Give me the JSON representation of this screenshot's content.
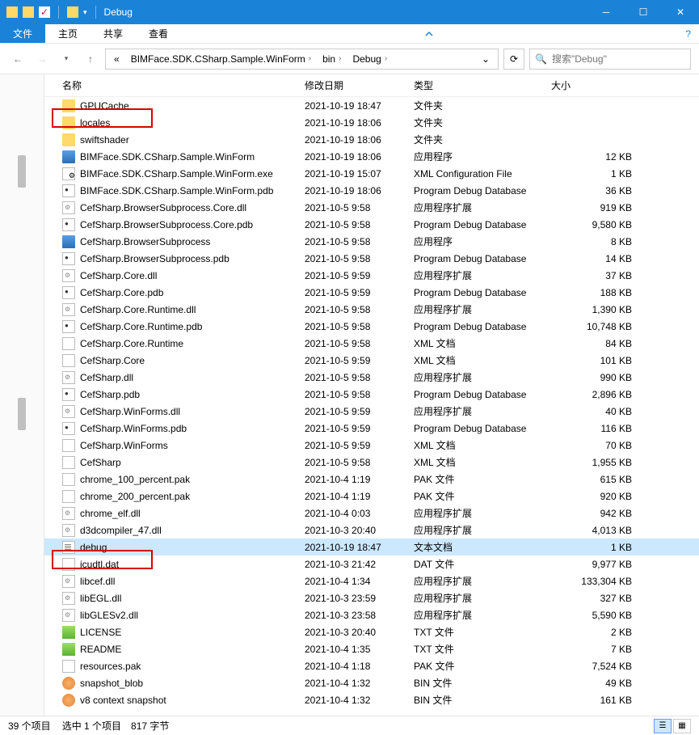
{
  "title": "Debug",
  "ribbon": {
    "file": "文件",
    "home": "主页",
    "share": "共享",
    "view": "查看"
  },
  "breadcrumb": {
    "part1": "BIMFace.SDK.CSharp.Sample.WinForm",
    "part2": "bin",
    "part3": "Debug"
  },
  "search": {
    "placeholder": "搜索\"Debug\""
  },
  "columns": {
    "name": "名称",
    "date": "修改日期",
    "type": "类型",
    "size": "大小"
  },
  "files": [
    {
      "n": "GPUCache",
      "d": "2021-10-19 18:47",
      "t": "文件夹",
      "s": "",
      "i": "folder"
    },
    {
      "n": "locales",
      "d": "2021-10-19 18:06",
      "t": "文件夹",
      "s": "",
      "i": "folder"
    },
    {
      "n": "swiftshader",
      "d": "2021-10-19 18:06",
      "t": "文件夹",
      "s": "",
      "i": "folder"
    },
    {
      "n": "BIMFace.SDK.CSharp.Sample.WinForm",
      "d": "2021-10-19 18:06",
      "t": "应用程序",
      "s": "12 KB",
      "i": "exe"
    },
    {
      "n": "BIMFace.SDK.CSharp.Sample.WinForm.exe",
      "d": "2021-10-19 15:07",
      "t": "XML Configuration File",
      "s": "1 KB",
      "i": "config"
    },
    {
      "n": "BIMFace.SDK.CSharp.Sample.WinForm.pdb",
      "d": "2021-10-19 18:06",
      "t": "Program Debug Database",
      "s": "36 KB",
      "i": "pdb"
    },
    {
      "n": "CefSharp.BrowserSubprocess.Core.dll",
      "d": "2021-10-5 9:58",
      "t": "应用程序扩展",
      "s": "919 KB",
      "i": "dll"
    },
    {
      "n": "CefSharp.BrowserSubprocess.Core.pdb",
      "d": "2021-10-5 9:58",
      "t": "Program Debug Database",
      "s": "9,580 KB",
      "i": "pdb"
    },
    {
      "n": "CefSharp.BrowserSubprocess",
      "d": "2021-10-5 9:58",
      "t": "应用程序",
      "s": "8 KB",
      "i": "exe"
    },
    {
      "n": "CefSharp.BrowserSubprocess.pdb",
      "d": "2021-10-5 9:58",
      "t": "Program Debug Database",
      "s": "14 KB",
      "i": "pdb"
    },
    {
      "n": "CefSharp.Core.dll",
      "d": "2021-10-5 9:59",
      "t": "应用程序扩展",
      "s": "37 KB",
      "i": "dll"
    },
    {
      "n": "CefSharp.Core.pdb",
      "d": "2021-10-5 9:59",
      "t": "Program Debug Database",
      "s": "188 KB",
      "i": "pdb"
    },
    {
      "n": "CefSharp.Core.Runtime.dll",
      "d": "2021-10-5 9:58",
      "t": "应用程序扩展",
      "s": "1,390 KB",
      "i": "dll"
    },
    {
      "n": "CefSharp.Core.Runtime.pdb",
      "d": "2021-10-5 9:58",
      "t": "Program Debug Database",
      "s": "10,748 KB",
      "i": "pdb"
    },
    {
      "n": "CefSharp.Core.Runtime",
      "d": "2021-10-5 9:58",
      "t": "XML 文档",
      "s": "84 KB",
      "i": "xml"
    },
    {
      "n": "CefSharp.Core",
      "d": "2021-10-5 9:59",
      "t": "XML 文档",
      "s": "101 KB",
      "i": "xml"
    },
    {
      "n": "CefSharp.dll",
      "d": "2021-10-5 9:58",
      "t": "应用程序扩展",
      "s": "990 KB",
      "i": "dll"
    },
    {
      "n": "CefSharp.pdb",
      "d": "2021-10-5 9:58",
      "t": "Program Debug Database",
      "s": "2,896 KB",
      "i": "pdb"
    },
    {
      "n": "CefSharp.WinForms.dll",
      "d": "2021-10-5 9:59",
      "t": "应用程序扩展",
      "s": "40 KB",
      "i": "dll"
    },
    {
      "n": "CefSharp.WinForms.pdb",
      "d": "2021-10-5 9:59",
      "t": "Program Debug Database",
      "s": "116 KB",
      "i": "pdb"
    },
    {
      "n": "CefSharp.WinForms",
      "d": "2021-10-5 9:59",
      "t": "XML 文档",
      "s": "70 KB",
      "i": "xml"
    },
    {
      "n": "CefSharp",
      "d": "2021-10-5 9:58",
      "t": "XML 文档",
      "s": "1,955 KB",
      "i": "xml"
    },
    {
      "n": "chrome_100_percent.pak",
      "d": "2021-10-4 1:19",
      "t": "PAK 文件",
      "s": "615 KB",
      "i": "pak"
    },
    {
      "n": "chrome_200_percent.pak",
      "d": "2021-10-4 1:19",
      "t": "PAK 文件",
      "s": "920 KB",
      "i": "pak"
    },
    {
      "n": "chrome_elf.dll",
      "d": "2021-10-4 0:03",
      "t": "应用程序扩展",
      "s": "942 KB",
      "i": "dll"
    },
    {
      "n": "d3dcompiler_47.dll",
      "d": "2021-10-3 20:40",
      "t": "应用程序扩展",
      "s": "4,013 KB",
      "i": "dll"
    },
    {
      "n": "debug",
      "d": "2021-10-19 18:47",
      "t": "文本文档",
      "s": "1 KB",
      "i": "txt",
      "sel": true
    },
    {
      "n": "icudtl.dat",
      "d": "2021-10-3 21:42",
      "t": "DAT 文件",
      "s": "9,977 KB",
      "i": "dat"
    },
    {
      "n": "libcef.dll",
      "d": "2021-10-4 1:34",
      "t": "应用程序扩展",
      "s": "133,304 KB",
      "i": "dll"
    },
    {
      "n": "libEGL.dll",
      "d": "2021-10-3 23:59",
      "t": "应用程序扩展",
      "s": "327 KB",
      "i": "dll"
    },
    {
      "n": "libGLESv2.dll",
      "d": "2021-10-3 23:58",
      "t": "应用程序扩展",
      "s": "5,590 KB",
      "i": "dll"
    },
    {
      "n": "LICENSE",
      "d": "2021-10-3 20:40",
      "t": "TXT 文件",
      "s": "2 KB",
      "i": "lic"
    },
    {
      "n": "README",
      "d": "2021-10-4 1:35",
      "t": "TXT 文件",
      "s": "7 KB",
      "i": "lic"
    },
    {
      "n": "resources.pak",
      "d": "2021-10-4 1:18",
      "t": "PAK 文件",
      "s": "7,524 KB",
      "i": "pak"
    },
    {
      "n": "snapshot_blob",
      "d": "2021-10-4 1:32",
      "t": "BIN 文件",
      "s": "49 KB",
      "i": "bin"
    },
    {
      "n": "v8 context snapshot",
      "d": "2021-10-4 1:32",
      "t": "BIN 文件",
      "s": "161 KB",
      "i": "bin"
    }
  ],
  "status": {
    "count": "39 个项目",
    "selection": "选中 1 个项目　817 字节"
  }
}
